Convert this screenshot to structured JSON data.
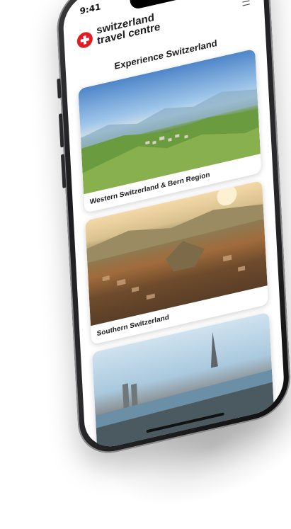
{
  "status_bar": {
    "time": "9:41"
  },
  "brand": {
    "line1": "switzerland",
    "line2": "travel centre",
    "accent": "#e31b23"
  },
  "page": {
    "title": "Experience Switzerland"
  },
  "regions": [
    {
      "label": "Western Switzerland & Bern Region"
    },
    {
      "label": "Southern Switzerland"
    },
    {
      "label": ""
    }
  ],
  "icons": {
    "menu": "hamburger-icon",
    "logo": "swiss-cross-icon",
    "signal": "signal-icon",
    "wifi": "wifi-icon",
    "battery": "battery-icon"
  }
}
